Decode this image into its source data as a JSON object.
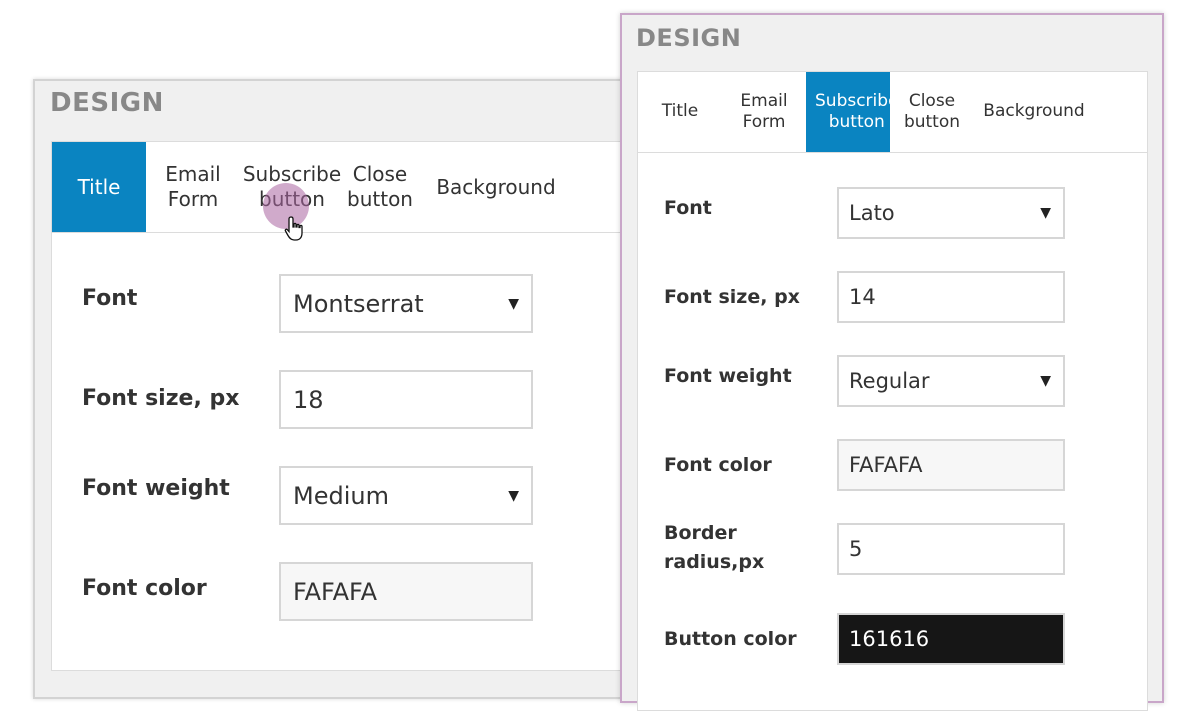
{
  "back_panel": {
    "title": "DESIGN",
    "tabs": [
      {
        "label_l1": "Title",
        "label_l2": ""
      },
      {
        "label_l1": "Email",
        "label_l2": "Form"
      },
      {
        "label_l1": "Subscribe",
        "label_l2": "button"
      },
      {
        "label_l1": "Close",
        "label_l2": "button"
      },
      {
        "label_l1": "Background",
        "label_l2": ""
      }
    ],
    "active_tab": "Title",
    "fields": {
      "font": {
        "label": "Font",
        "value": "Montserrat"
      },
      "font_size": {
        "label": "Font size, px",
        "value": "18"
      },
      "font_weight": {
        "label": "Font weight",
        "value": "Medium"
      },
      "font_color": {
        "label": "Font color",
        "value": "FAFAFA"
      }
    }
  },
  "front_panel": {
    "title": "DESIGN",
    "tabs": [
      {
        "label_l1": "Title",
        "label_l2": ""
      },
      {
        "label_l1": "Email",
        "label_l2": "Form"
      },
      {
        "label_l1": "Subscribe",
        "label_l2": "button"
      },
      {
        "label_l1": "Close",
        "label_l2": "button"
      },
      {
        "label_l1": "Background",
        "label_l2": ""
      }
    ],
    "active_tab": "Subscribe button",
    "fields": {
      "font": {
        "label": "Font",
        "value": "Lato"
      },
      "font_size": {
        "label": "Font size, px",
        "value": "14"
      },
      "font_weight": {
        "label": "Font weight",
        "value": "Regular"
      },
      "font_color": {
        "label": "Font color",
        "value": "FAFAFA"
      },
      "border_radius": {
        "label_l1": "Border",
        "label_l2": "radius,px",
        "value": "5"
      },
      "button_color": {
        "label": "Button color",
        "value": "161616"
      }
    }
  },
  "colors": {
    "accent": "#0a84c1",
    "click_indicator": "#b77fb3",
    "button_color_swatch": "#161616"
  },
  "icons": {
    "dropdown": "caret-down-icon",
    "cursor": "hand-pointer-icon"
  }
}
